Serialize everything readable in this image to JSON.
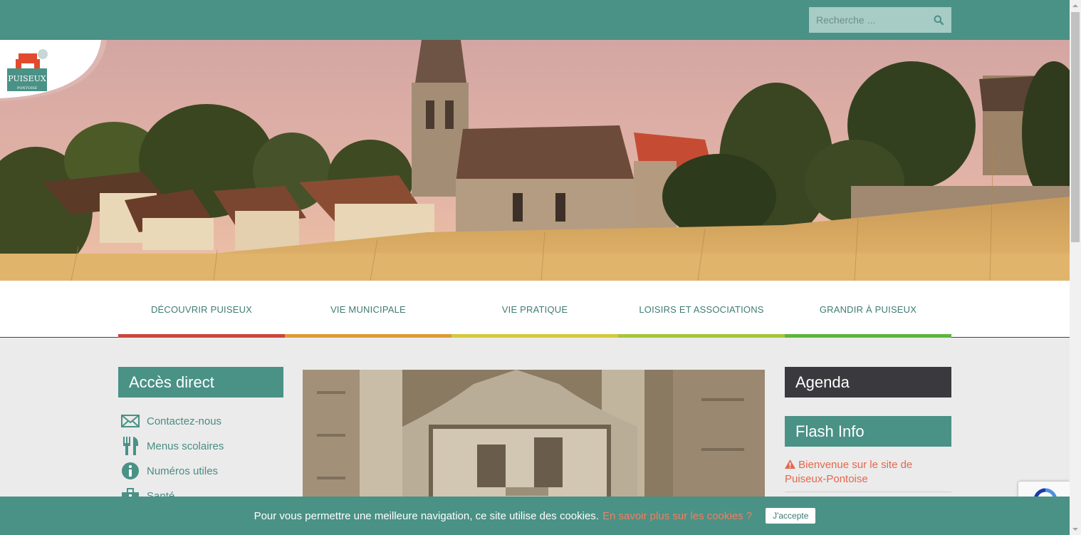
{
  "search": {
    "placeholder": "Recherche ..."
  },
  "logo": {
    "text": "PUISEUX",
    "subtext": "PONTOISE"
  },
  "nav": [
    {
      "label": "DÉCOUVRIR PUISEUX",
      "color": "#c9463d"
    },
    {
      "label": "VIE MUNICIPALE",
      "color": "#dd9a35"
    },
    {
      "label": "VIE PRATIQUE",
      "color": "#d4c93a"
    },
    {
      "label": "LOISIRS ET ASSOCIATIONS",
      "color": "#a7c53a"
    },
    {
      "label": "GRANDIR À PUISEUX",
      "color": "#5db53c"
    }
  ],
  "acces": {
    "title": "Accès direct",
    "items": [
      {
        "label": "Contactez-nous",
        "icon": "envelope-icon"
      },
      {
        "label": "Menus scolaires",
        "icon": "utensils-icon"
      },
      {
        "label": "Numéros utiles",
        "icon": "info-icon"
      },
      {
        "label": "Santé",
        "icon": "medical-icon"
      }
    ]
  },
  "agenda": {
    "title": "Agenda"
  },
  "flash": {
    "title": "Flash Info",
    "item": "Bienvenue sur le site de Puiseux-Pontoise"
  },
  "cookie": {
    "text": "Pour vous permettre une meilleure navigation, ce site utilise des cookies.",
    "link": "En savoir plus sur les cookies ?",
    "button": "J'accepte"
  },
  "colors": {
    "primary": "#4a9186",
    "dark": "#3a3a3e",
    "accent": "#e4674e"
  }
}
